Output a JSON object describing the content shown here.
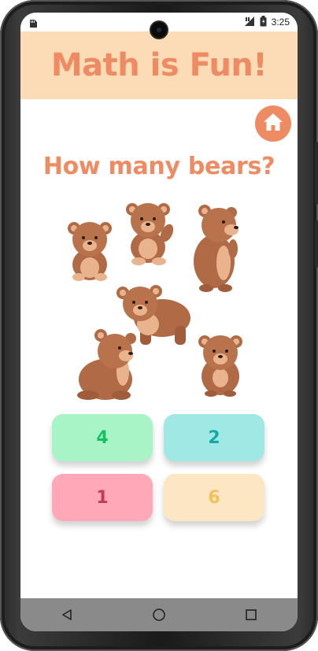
{
  "status": {
    "time": "3:25",
    "icons": [
      "sd-card-icon",
      "signal-icon",
      "battery-icon"
    ]
  },
  "app": {
    "title": "Math is Fun!",
    "home_icon": "home-icon"
  },
  "question": {
    "text": "How many bears?",
    "bear_count_shown": 6
  },
  "answers": [
    {
      "label": "4",
      "bg": "#a9f4c7",
      "fg": "#1bbf63"
    },
    {
      "label": "2",
      "bg": "#a0e8e4",
      "fg": "#14a9a4"
    },
    {
      "label": "1",
      "bg": "#ffa8b7",
      "fg": "#c23a57"
    },
    {
      "label": "6",
      "bg": "#fde6c3",
      "fg": "#f3c15b"
    }
  ],
  "navbar": {
    "items": [
      "back-icon",
      "home-circle-icon",
      "recents-icon"
    ]
  },
  "colors": {
    "accent": "#ef8b62",
    "banner_bg": "#fbdcb6",
    "bear_fur": "#b06a46",
    "bear_light": "#e9b48d"
  }
}
